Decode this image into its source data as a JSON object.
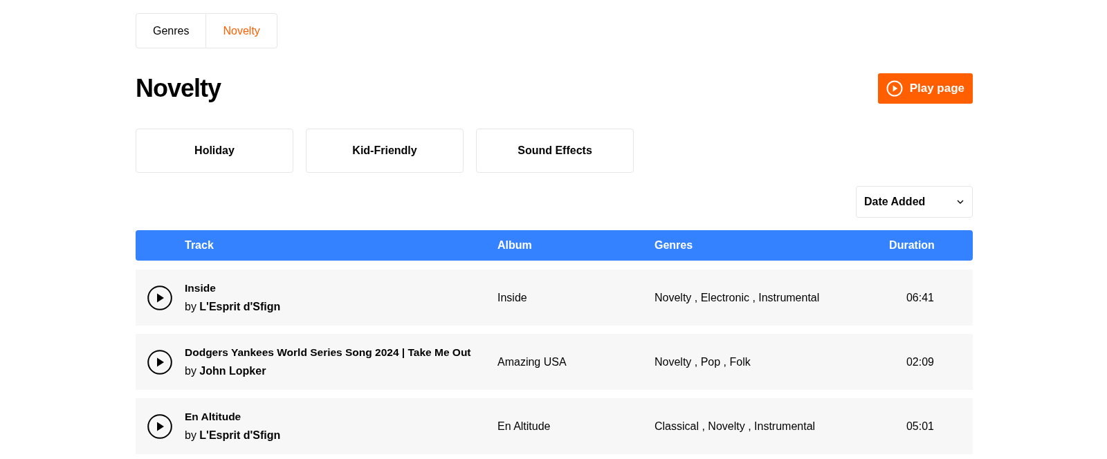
{
  "breadcrumb": [
    {
      "label": "Genres",
      "selected": false
    },
    {
      "label": "Novelty",
      "selected": true
    }
  ],
  "heading": "Novelty",
  "play_button": {
    "label": "Play page"
  },
  "categories": [
    "Holiday",
    "Kid-Friendly",
    "Sound Effects"
  ],
  "sort": {
    "value": "Date Added"
  },
  "table": {
    "columns": [
      "Track",
      "Album",
      "Genres",
      "Duration"
    ],
    "rows": [
      {
        "title": "Inside",
        "artist": "by **L'Esprit d'Sfign**",
        "album": "Inside",
        "genres": "Novelty , Electronic , Instrumental",
        "duration": "06:41"
      },
      {
        "title": "Dodgers Yankees World Series Song 2024 | Take Me Out",
        "artist": "by **John Lopker**",
        "album": "Amazing USA",
        "genres": "Novelty , Pop , Folk",
        "duration": "02:09"
      },
      {
        "title": "En Altitude",
        "artist": "by **L'Esprit d'Sfign**",
        "album": "En Altitude",
        "genres": "Classical , Novelty , Instrumental",
        "duration": "05:01"
      }
    ]
  }
}
